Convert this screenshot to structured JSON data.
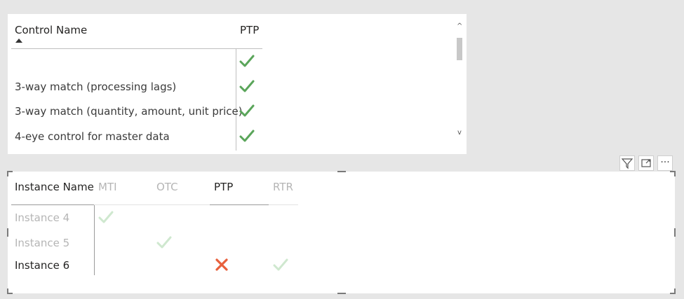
{
  "top_table": {
    "col_control": "Control Name",
    "col_ptp": "PTP",
    "sort_indicator": "up-triangle",
    "rows": [
      {
        "name": "",
        "ptp": "check"
      },
      {
        "name": "3-way match (processing lags)",
        "ptp": "check"
      },
      {
        "name": "3-way match (quantity, amount, unit price)",
        "ptp": "check"
      },
      {
        "name": "4-eye control for master data",
        "ptp": "check"
      }
    ],
    "scroll_up": "^",
    "scroll_down": "v"
  },
  "visual_toolbar": {
    "filter_icon": "filter-icon",
    "focus_icon": "focus-mode-icon",
    "more_label": "···"
  },
  "bottom_table": {
    "col_instance": "Instance Name",
    "col_mti": "MTI",
    "col_otc": "OTC",
    "col_ptp": "PTP",
    "col_rtr": "RTR",
    "rows": [
      {
        "name": "Instance 4",
        "mti": "check",
        "otc": "",
        "ptp": "",
        "rtr": ""
      },
      {
        "name": "Instance 5",
        "mti": "",
        "otc": "check",
        "ptp": "",
        "rtr": ""
      },
      {
        "name": "Instance 6",
        "mti": "",
        "otc": "",
        "ptp": "x",
        "rtr": "check"
      }
    ]
  },
  "colors": {
    "check_green": "#5aa55a",
    "check_faded": "#cfe8cf",
    "x_red": "#e8603c",
    "faded_text": "#b5b5b5"
  }
}
